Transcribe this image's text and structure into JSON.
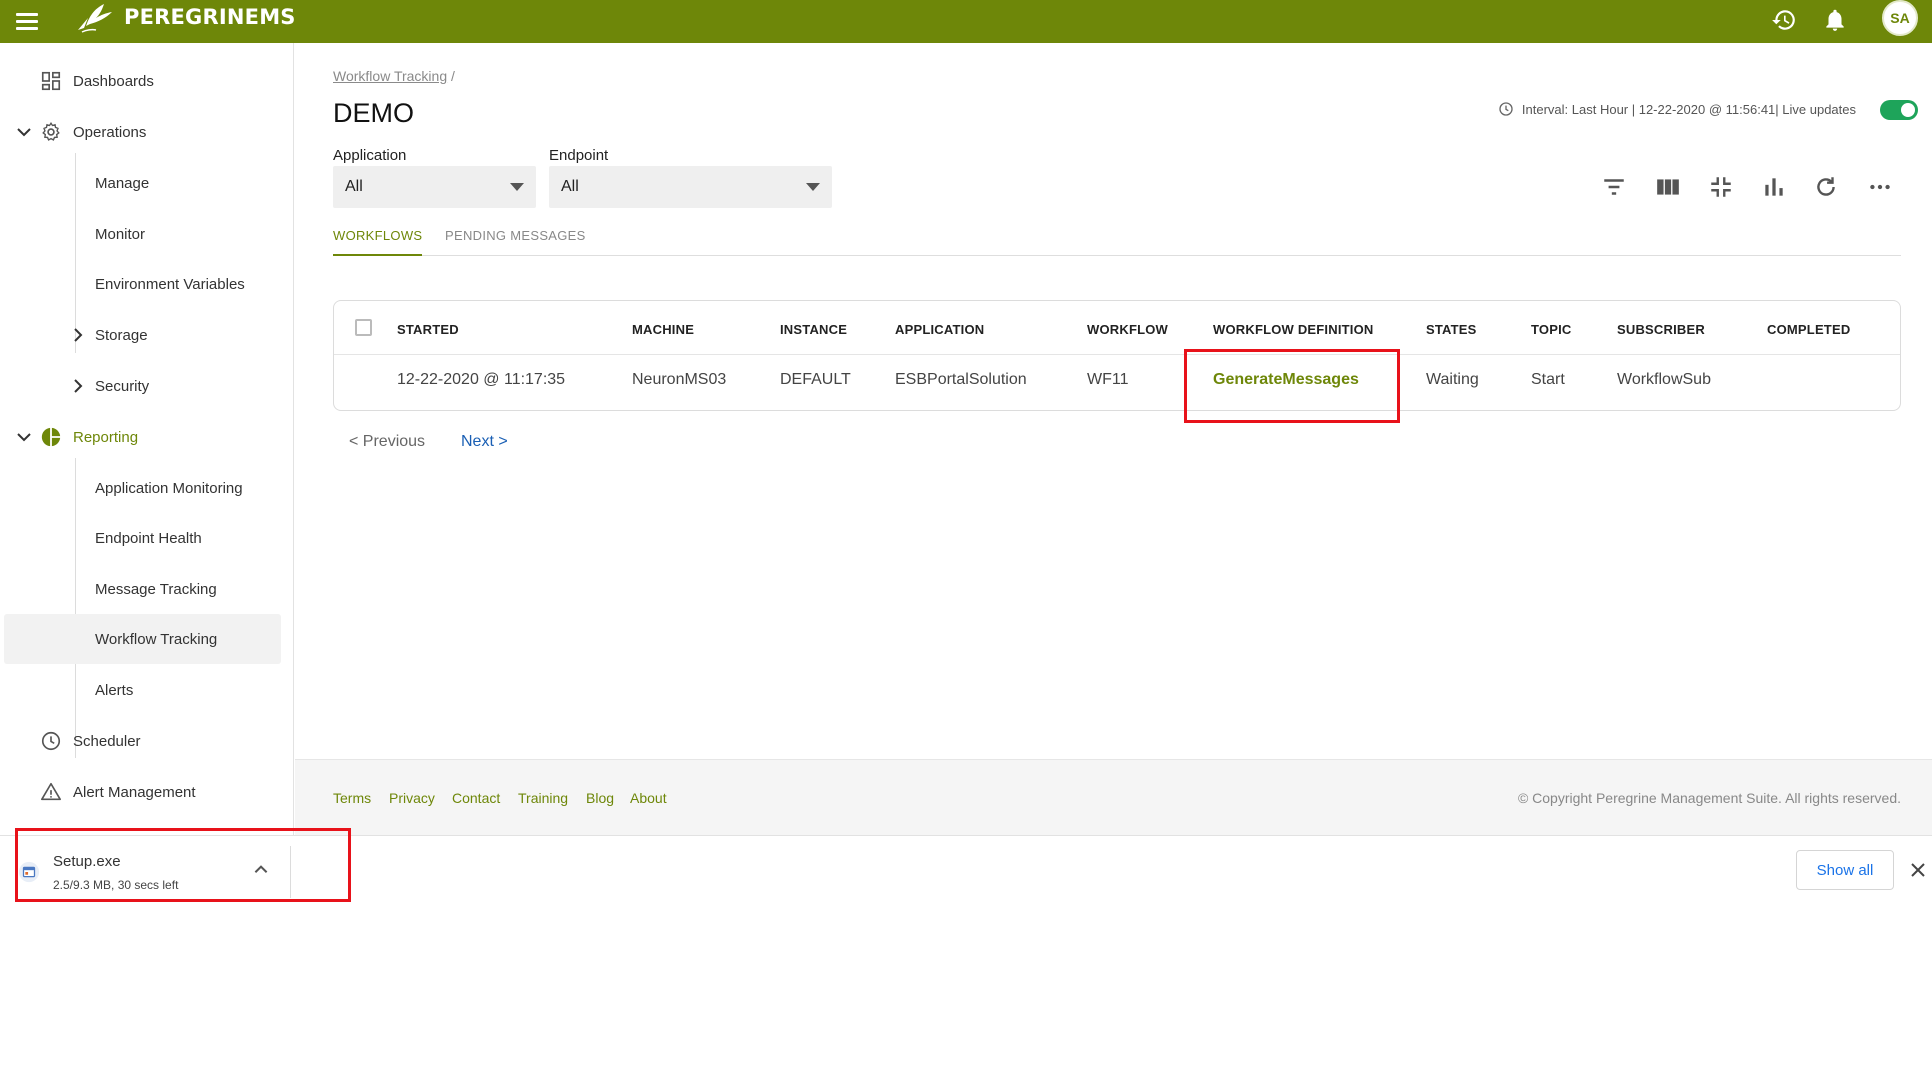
{
  "app": {
    "logo_text": "PEREGRINEMS",
    "user_initials": "SA"
  },
  "colors": {
    "brand": "#6e8709",
    "toggle_on": "#1ea45a",
    "highlight": "#e8121a",
    "link_blue": "#1a73e8"
  },
  "sidebar": {
    "dashboards": "Dashboards",
    "operations": "Operations",
    "manage": "Manage",
    "monitor": "Monitor",
    "env_vars": "Environment Variables",
    "storage": "Storage",
    "security": "Security",
    "reporting": "Reporting",
    "app_monitoring": "Application Monitoring",
    "endpoint_health": "Endpoint Health",
    "message_tracking": "Message Tracking",
    "workflow_tracking": "Workflow Tracking",
    "alerts": "Alerts",
    "scheduler": "Scheduler",
    "alert_management": "Alert Management"
  },
  "page": {
    "breadcrumb_link": "Workflow Tracking",
    "breadcrumb_sep": "/",
    "title": "DEMO",
    "interval_text": "Interval: Last Hour | 12-22-2020 @ 11:56:41| Live updates",
    "live_updates": true
  },
  "filters": {
    "application_label": "Application",
    "application_value": "All",
    "endpoint_label": "Endpoint",
    "endpoint_value": "All"
  },
  "tabs": {
    "workflows": "WORKFLOWS",
    "pending": "PENDING MESSAGES"
  },
  "table": {
    "headers": {
      "started": "STARTED",
      "machine": "MACHINE",
      "instance": "INSTANCE",
      "application": "APPLICATION",
      "workflow": "WORKFLOW",
      "definition": "WORKFLOW DEFINITION",
      "states": "STATES",
      "topic": "TOPIC",
      "subscriber": "SUBSCRIBER",
      "completed": "COMPLETED"
    },
    "rows": [
      {
        "started": "12-22-2020 @ 11:17:35",
        "machine": "NeuronMS03",
        "instance": "DEFAULT",
        "application": "ESBPortalSolution",
        "workflow": "WF11",
        "definition": "GenerateMessages",
        "states": "Waiting",
        "topic": "Start",
        "subscriber": "WorkflowSub",
        "completed": ""
      }
    ]
  },
  "pager": {
    "previous": "< Previous",
    "next": "Next >"
  },
  "footer": {
    "terms": "Terms",
    "privacy": "Privacy",
    "contact": "Contact",
    "training": "Training",
    "blog": "Blog",
    "about": "About",
    "copyright": "© Copyright Peregrine Management Suite. All rights reserved."
  },
  "download": {
    "file_name": "Setup.exe",
    "status": "2.5/9.3 MB, 30 secs left",
    "show_all": "Show all"
  }
}
